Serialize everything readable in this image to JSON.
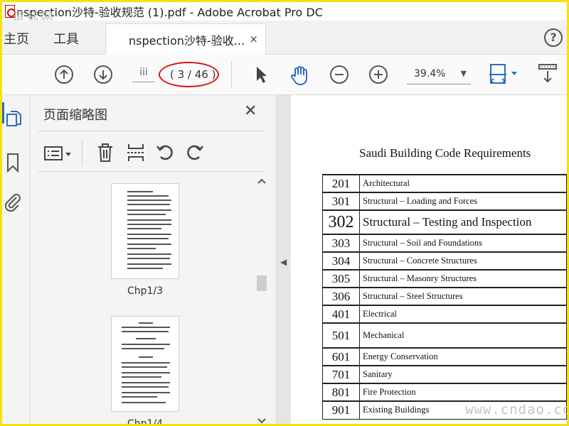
{
  "window": {
    "title": "nspection沙特-验收规范 (1).pdf - Adobe Acrobat Pro DC",
    "watermark_top": "道标网"
  },
  "tabs": {
    "home_label": "主页",
    "tools_label": "工具",
    "document_label": "nspection沙特-验收...",
    "close_glyph": "×",
    "help_glyph": "?"
  },
  "toolbar": {
    "page_input_value": "iii",
    "page_count": "( 3 / 46 )",
    "zoom_value": "39.4%",
    "zoom_caret": "▼",
    "icons": [
      "page-up-icon",
      "page-down-icon",
      "select-cursor-icon",
      "hand-tool-icon",
      "zoom-out-icon",
      "zoom-in-icon",
      "fit-page-icon",
      "scroll-mode-icon"
    ],
    "accent_color": "#2b6cc7",
    "annotation_color": "#e01010"
  },
  "thumbnails": {
    "title": "页面缩略图",
    "close_glyph": "✕",
    "pages": [
      {
        "label": "Chp1/3"
      },
      {
        "label": "Chp1/4"
      }
    ],
    "collapse_glyph": "◀"
  },
  "document": {
    "heading": "Saudi Building Code Requirements",
    "rows": [
      {
        "num": "201",
        "name": "Architectural"
      },
      {
        "num": "301",
        "name": "Structural – Loading and Forces"
      },
      {
        "num": "302",
        "name": "Structural – Testing and Inspection"
      },
      {
        "num": "303",
        "name": "Structural – Soil and Foundations"
      },
      {
        "num": "304",
        "name": "Structural – Concrete Structures"
      },
      {
        "num": "305",
        "name": "Structural – Masonry Structures"
      },
      {
        "num": "306",
        "name": "Structural – Steel Structures"
      },
      {
        "num": "401",
        "name": "Electrical"
      },
      {
        "num": "501",
        "name": "Mechanical"
      },
      {
        "num": "601",
        "name": "Energy Conservation"
      },
      {
        "num": "701",
        "name": "Sanitary"
      },
      {
        "num": "801",
        "name": "Fire Protection"
      },
      {
        "num": "901",
        "name": "Existing Buildings"
      }
    ]
  },
  "watermark_bottom": "www.cndao.com"
}
